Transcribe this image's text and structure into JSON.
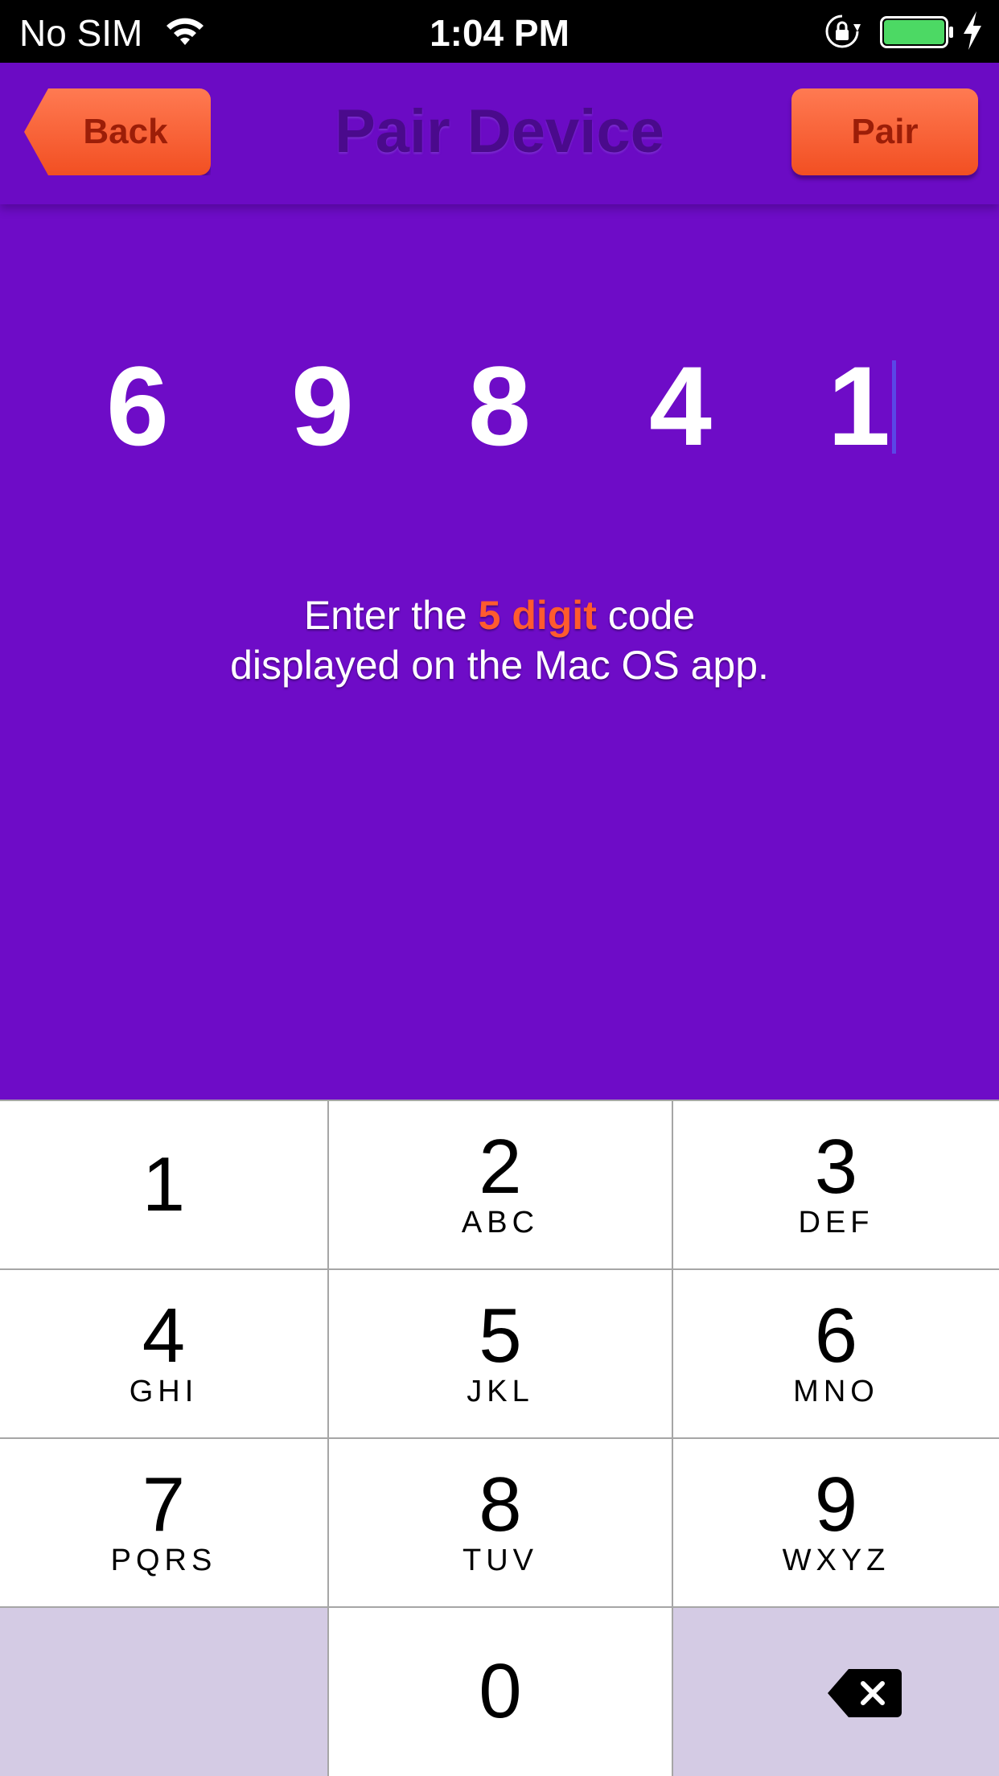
{
  "status_bar": {
    "carrier": "No SIM",
    "time": "1:04 PM",
    "wifi_icon": "wifi-icon",
    "lock_icon": "rotation-lock-icon",
    "battery_icon": "battery-icon",
    "charging_icon": "charging-bolt-icon",
    "battery_level": 1.0,
    "battery_color": "#4cd964"
  },
  "nav": {
    "title": "Pair Device",
    "back_label": "Back",
    "pair_label": "Pair"
  },
  "code": {
    "digits": [
      "6",
      "9",
      "8",
      "4",
      "1"
    ]
  },
  "instruction": {
    "pre": "Enter the",
    "highlight": "5 digit",
    "post": "code",
    "line2": "displayed on the Mac OS app."
  },
  "keypad": {
    "keys": [
      {
        "num": "1",
        "letters": ""
      },
      {
        "num": "2",
        "letters": "ABC"
      },
      {
        "num": "3",
        "letters": "DEF"
      },
      {
        "num": "4",
        "letters": "GHI"
      },
      {
        "num": "5",
        "letters": "JKL"
      },
      {
        "num": "6",
        "letters": "MNO"
      },
      {
        "num": "7",
        "letters": "PQRS"
      },
      {
        "num": "8",
        "letters": "TUV"
      },
      {
        "num": "9",
        "letters": "WXYZ"
      },
      {
        "num": "0",
        "letters": ""
      }
    ],
    "delete_icon": "delete-backspace-icon"
  },
  "colors": {
    "background": "#6e0cc7",
    "title": "#4a0a8c",
    "button": "#f65a2a",
    "button_text": "#9c1e08",
    "highlight": "#ff5b2e",
    "cursor": "#5a47e6",
    "keypad_dim": "#d4cbe4"
  }
}
